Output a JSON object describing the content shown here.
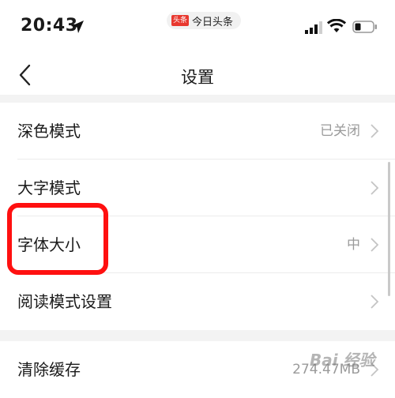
{
  "status_bar": {
    "time": "20:43",
    "app_logo": "头条",
    "app_name": "今日头条"
  },
  "nav": {
    "title": "设置"
  },
  "settings": [
    {
      "label": "深色模式",
      "value": "已关闭"
    },
    {
      "label": "大字模式",
      "value": ""
    },
    {
      "label": "字体大小",
      "value": "中"
    },
    {
      "label": "阅读模式设置",
      "value": ""
    },
    {
      "label": "清除缓存",
      "value": "274.47MB"
    }
  ],
  "watermark": "Bai 经验",
  "colors": {
    "highlight": "#ff1010",
    "logo_red": "#e8382f",
    "secondary_text": "#9a9a9a"
  }
}
